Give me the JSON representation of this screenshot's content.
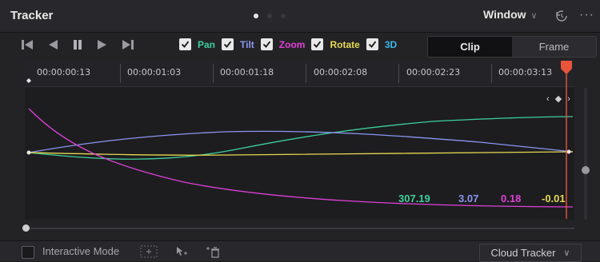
{
  "panel": {
    "title": "Tracker",
    "pager": {
      "pages": 3,
      "active": 0
    },
    "window_menu": "Window",
    "window_chevron": "∨",
    "more": "···"
  },
  "toolbar": {
    "transport": [
      "skip-to-start-icon",
      "play-reverse-icon",
      "pause-icon",
      "play-forward-icon",
      "skip-to-end-icon"
    ],
    "checks": [
      {
        "label": "Pan",
        "color": "#3ecf9a",
        "checked": true
      },
      {
        "label": "Tilt",
        "color": "#8a96f0",
        "checked": true
      },
      {
        "label": "Zoom",
        "color": "#e040d8",
        "checked": true
      },
      {
        "label": "Rotate",
        "color": "#e6d850",
        "checked": true
      },
      {
        "label": "3D",
        "color": "#3fb8e8",
        "checked": true
      }
    ],
    "segments": {
      "clip": "Clip",
      "frame": "Frame",
      "selected": "Clip"
    }
  },
  "ruler": {
    "timecodes": [
      "00:00:00:13",
      "00:00:01:03",
      "00:00:01:18",
      "00:00:02:08",
      "00:00:02:23",
      "00:00:03:13"
    ]
  },
  "values": {
    "pan": "307.19",
    "tilt": "3.07",
    "zoom": "0.18",
    "rotate": "-0.01"
  },
  "colors": {
    "pan": "#3ecf9a",
    "tilt": "#8a96f0",
    "zoom": "#e040d8",
    "rotate": "#e6d850",
    "playhead": "#e8553a"
  },
  "bottom": {
    "interactive_mode": "Interactive Mode",
    "cloud_tracker": "Cloud Tracker",
    "cloud_chevron": "∨"
  },
  "keyframe_nav": "‹ ◆ ›"
}
